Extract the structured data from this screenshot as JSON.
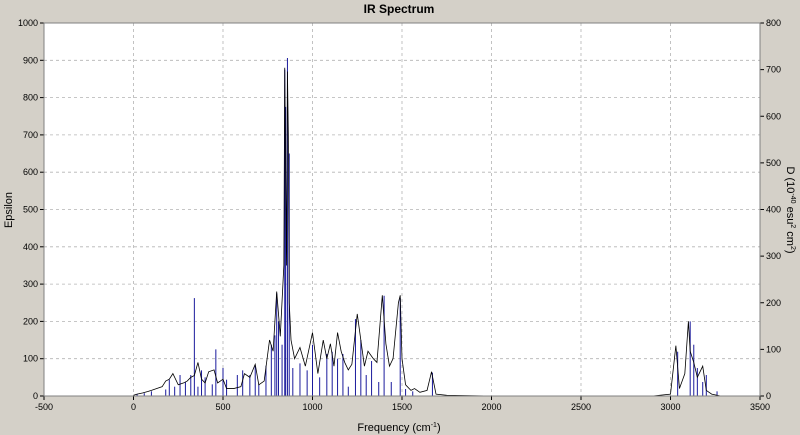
{
  "chart_data": {
    "type": "line",
    "title": "IR Spectrum",
    "xlabel": "Frequency (cm",
    "xlabel_sup": "-1",
    "xlabel_end": ")",
    "ylabel": "Epsilon",
    "y2label_parts": [
      "D (10",
      "-40",
      " esu",
      "2",
      " cm",
      "2",
      ")"
    ],
    "xlim": [
      -500,
      3500
    ],
    "ylim": [
      0,
      1000
    ],
    "y2lim": [
      0,
      800
    ],
    "x_ticks": [
      -500,
      0,
      500,
      1000,
      1500,
      2000,
      2500,
      3000,
      3500
    ],
    "y_ticks": [
      0,
      100,
      200,
      300,
      400,
      500,
      600,
      700,
      800,
      900,
      1000
    ],
    "y2_ticks": [
      0,
      100,
      200,
      300,
      400,
      500,
      600,
      700,
      800
    ],
    "grid": true,
    "colors": {
      "epsilon": "#000000",
      "intensity": "#1a1a9c",
      "background": "#ffffff",
      "grid": "#b4b4b4"
    },
    "series": [
      {
        "axis": "left",
        "style": "line",
        "color": "#000000",
        "x": [
          0,
          20,
          50,
          80,
          100,
          130,
          160,
          180,
          200,
          220,
          250,
          280,
          300,
          320,
          340,
          360,
          380,
          400,
          420,
          450,
          470,
          500,
          520,
          560,
          600,
          620,
          650,
          680,
          700,
          730,
          760,
          780,
          800,
          820,
          840,
          845,
          850,
          855,
          860,
          865,
          870,
          880,
          900,
          930,
          960,
          1000,
          1030,
          1060,
          1080,
          1100,
          1120,
          1140,
          1160,
          1180,
          1200,
          1220,
          1250,
          1270,
          1290,
          1310,
          1340,
          1360,
          1390,
          1410,
          1430,
          1450,
          1480,
          1490,
          1500,
          1520,
          1550,
          1570,
          1600,
          1640,
          1665,
          1690,
          1750,
          2000,
          2500,
          2900,
          3000,
          3030,
          3050,
          3080,
          3100,
          3110,
          3130,
          3150,
          3180,
          3200,
          3230,
          3260,
          3280,
          3300,
          3400
        ],
        "y": [
          2,
          5,
          8,
          12,
          15,
          20,
          25,
          40,
          45,
          60,
          30,
          35,
          40,
          50,
          55,
          90,
          45,
          35,
          65,
          70,
          35,
          45,
          20,
          20,
          25,
          60,
          50,
          85,
          30,
          40,
          150,
          120,
          280,
          160,
          350,
          880,
          600,
          350,
          870,
          700,
          250,
          150,
          100,
          130,
          80,
          170,
          60,
          150,
          100,
          140,
          80,
          170,
          120,
          90,
          70,
          85,
          220,
          150,
          80,
          120,
          100,
          90,
          270,
          140,
          80,
          100,
          250,
          270,
          100,
          30,
          15,
          20,
          10,
          15,
          65,
          5,
          2,
          0,
          0,
          0,
          5,
          135,
          20,
          60,
          200,
          120,
          90,
          50,
          80,
          15,
          5,
          2,
          0,
          0,
          0
        ]
      },
      {
        "axis": "right",
        "style": "sticks",
        "color": "#1a1a9c",
        "x": [
          20,
          60,
          100,
          180,
          200,
          230,
          260,
          290,
          320,
          340,
          360,
          380,
          400,
          440,
          460,
          500,
          520,
          580,
          610,
          650,
          680,
          700,
          740,
          770,
          790,
          800,
          810,
          830,
          845,
          850,
          860,
          870,
          890,
          930,
          970,
          1000,
          1040,
          1080,
          1110,
          1140,
          1170,
          1200,
          1240,
          1270,
          1300,
          1330,
          1370,
          1400,
          1440,
          1490,
          1520,
          1560,
          1670,
          3040,
          3110,
          3130,
          3150,
          3180,
          3200,
          3260
        ],
        "y": [
          4,
          6,
          10,
          14,
          35,
          20,
          45,
          30,
          45,
          210,
          20,
          55,
          40,
          25,
          100,
          60,
          35,
          45,
          55,
          45,
          65,
          25,
          65,
          110,
          130,
          220,
          160,
          110,
          700,
          620,
          725,
          520,
          60,
          70,
          55,
          110,
          40,
          90,
          95,
          80,
          90,
          20,
          165,
          120,
          45,
          75,
          30,
          215,
          30,
          210,
          15,
          10,
          50,
          95,
          160,
          110,
          60,
          30,
          45,
          10
        ]
      }
    ]
  }
}
